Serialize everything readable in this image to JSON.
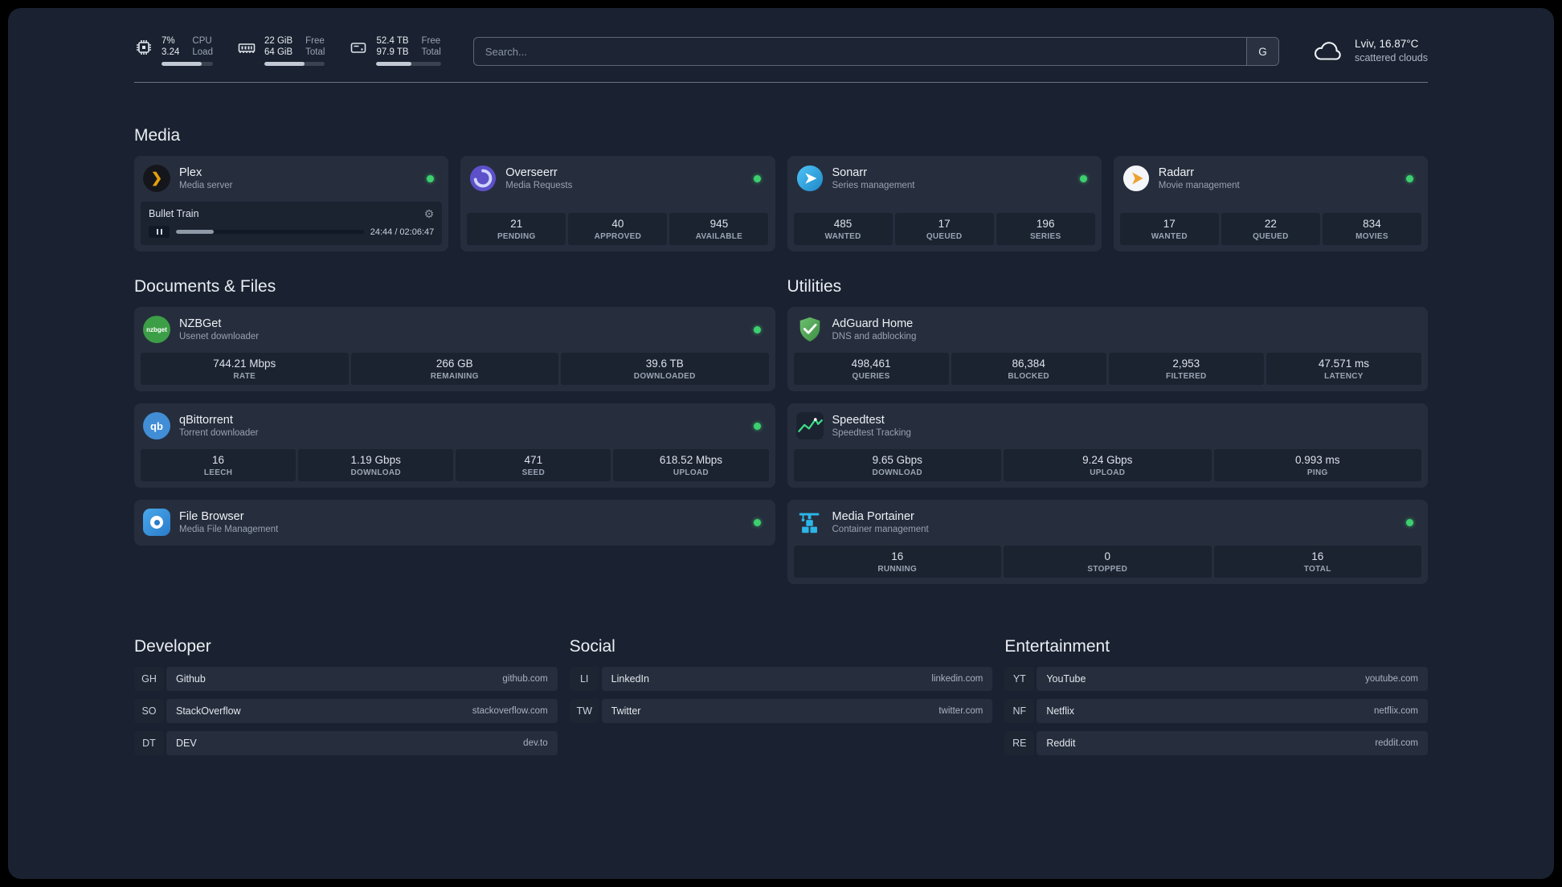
{
  "icons": {
    "plex_glyph": "❯",
    "gear_glyph": "⚙",
    "nzbget_text": "nzbget",
    "qbittorrent_text": "qb"
  },
  "colors": {
    "status_online": "#3dd06e",
    "plex_accent": "#e5a00d",
    "overseerr_accent": "#5d50c9",
    "sonarr_accent": "#35c5f4",
    "radarr_accent": "#eda12f",
    "nzbget_accent": "#3c9e46",
    "qbittorrent_accent": "#418ed6",
    "filebrowser_accent": "#2a7cc9",
    "adguard_accent": "#57b85c",
    "speedtest_accent": "#3ddc84",
    "portainer_accent": "#2db5e8"
  },
  "topbar": {
    "resources": [
      {
        "icon": "cpu-icon",
        "value_top": "7%",
        "value_bottom": "3.24",
        "label_top": "CPU",
        "label_bottom": "Load",
        "progress": 78
      },
      {
        "icon": "memory-icon",
        "value_top": "22 GiB",
        "value_bottom": "64 GiB",
        "label_top": "Free",
        "label_bottom": "Total",
        "progress": 66
      },
      {
        "icon": "disk-icon",
        "value_top": "52.4 TB",
        "value_bottom": "97.9 TB",
        "label_top": "Free",
        "label_bottom": "Total",
        "progress": 54
      }
    ],
    "search": {
      "placeholder": "Search...",
      "button_label": "G"
    },
    "weather": {
      "location": "Lviv, 16.87°C",
      "condition": "scattered clouds"
    }
  },
  "sections": {
    "media": {
      "title": "Media",
      "plex": {
        "name": "Plex",
        "subtitle": "Media server",
        "now_playing": {
          "title": "Bullet Train",
          "time": "24:44 / 02:06:47",
          "progress": 20
        }
      },
      "overseerr": {
        "name": "Overseerr",
        "subtitle": "Media Requests",
        "stats": [
          {
            "value": "21",
            "label": "PENDING"
          },
          {
            "value": "40",
            "label": "APPROVED"
          },
          {
            "value": "945",
            "label": "AVAILABLE"
          }
        ]
      },
      "sonarr": {
        "name": "Sonarr",
        "subtitle": "Series management",
        "stats": [
          {
            "value": "485",
            "label": "WANTED"
          },
          {
            "value": "17",
            "label": "QUEUED"
          },
          {
            "value": "196",
            "label": "SERIES"
          }
        ]
      },
      "radarr": {
        "name": "Radarr",
        "subtitle": "Movie management",
        "stats": [
          {
            "value": "17",
            "label": "WANTED"
          },
          {
            "value": "22",
            "label": "QUEUED"
          },
          {
            "value": "834",
            "label": "MOVIES"
          }
        ]
      }
    },
    "documents": {
      "title": "Documents & Files",
      "nzbget": {
        "name": "NZBGet",
        "subtitle": "Usenet downloader",
        "stats": [
          {
            "value": "744.21 Mbps",
            "label": "RATE"
          },
          {
            "value": "266 GB",
            "label": "REMAINING"
          },
          {
            "value": "39.6 TB",
            "label": "DOWNLOADED"
          }
        ]
      },
      "qbittorrent": {
        "name": "qBittorrent",
        "subtitle": "Torrent downloader",
        "stats": [
          {
            "value": "16",
            "label": "LEECH"
          },
          {
            "value": "1.19 Gbps",
            "label": "DOWNLOAD"
          },
          {
            "value": "471",
            "label": "SEED"
          },
          {
            "value": "618.52 Mbps",
            "label": "UPLOAD"
          }
        ]
      },
      "filebrowser": {
        "name": "File Browser",
        "subtitle": "Media File Management"
      }
    },
    "utilities": {
      "title": "Utilities",
      "adguard": {
        "name": "AdGuard Home",
        "subtitle": "DNS and adblocking",
        "stats": [
          {
            "value": "498,461",
            "label": "QUERIES"
          },
          {
            "value": "86,384",
            "label": "BLOCKED"
          },
          {
            "value": "2,953",
            "label": "FILTERED"
          },
          {
            "value": "47.571 ms",
            "label": "LATENCY"
          }
        ]
      },
      "speedtest": {
        "name": "Speedtest",
        "subtitle": "Speedtest Tracking",
        "stats": [
          {
            "value": "9.65 Gbps",
            "label": "DOWNLOAD"
          },
          {
            "value": "9.24 Gbps",
            "label": "UPLOAD"
          },
          {
            "value": "0.993 ms",
            "label": "PING"
          }
        ]
      },
      "portainer": {
        "name": "Media Portainer",
        "subtitle": "Container management",
        "stats": [
          {
            "value": "16",
            "label": "RUNNING"
          },
          {
            "value": "0",
            "label": "STOPPED"
          },
          {
            "value": "16",
            "label": "TOTAL"
          }
        ]
      }
    }
  },
  "bookmarks": {
    "developer": {
      "title": "Developer",
      "items": [
        {
          "abbr": "GH",
          "name": "Github",
          "url": "github.com"
        },
        {
          "abbr": "SO",
          "name": "StackOverflow",
          "url": "stackoverflow.com"
        },
        {
          "abbr": "DT",
          "name": "DEV",
          "url": "dev.to"
        }
      ]
    },
    "social": {
      "title": "Social",
      "items": [
        {
          "abbr": "LI",
          "name": "LinkedIn",
          "url": "linkedin.com"
        },
        {
          "abbr": "TW",
          "name": "Twitter",
          "url": "twitter.com"
        }
      ]
    },
    "entertainment": {
      "title": "Entertainment",
      "items": [
        {
          "abbr": "YT",
          "name": "YouTube",
          "url": "youtube.com"
        },
        {
          "abbr": "NF",
          "name": "Netflix",
          "url": "netflix.com"
        },
        {
          "abbr": "RE",
          "name": "Reddit",
          "url": "reddit.com"
        }
      ]
    }
  }
}
